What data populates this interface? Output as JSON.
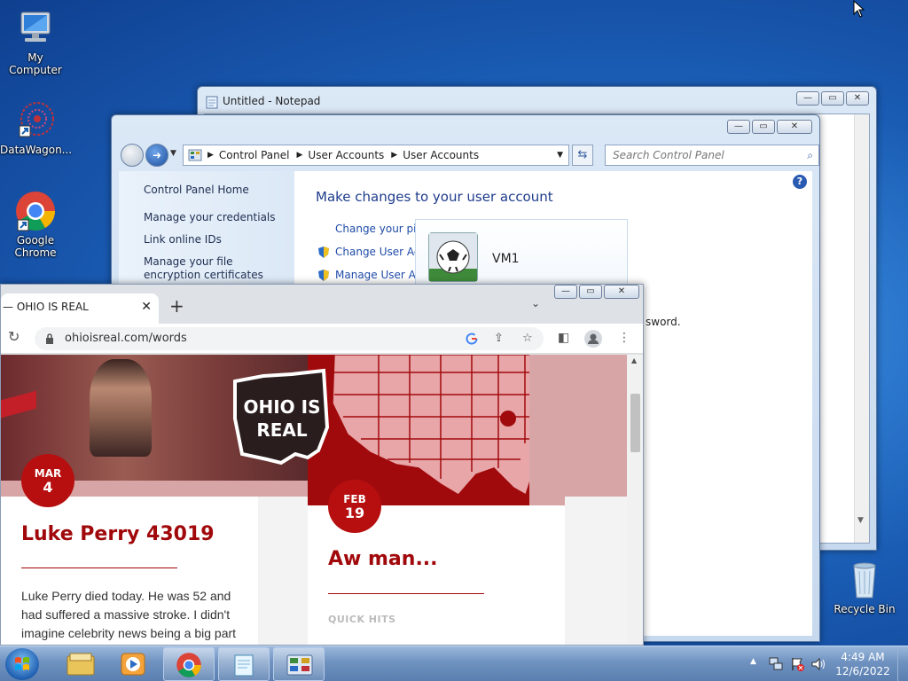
{
  "desktop": {
    "icons": [
      {
        "label": "My Computer",
        "icon": "computer-icon"
      },
      {
        "label": "DataWagon...",
        "icon": "datawagon-icon"
      },
      {
        "label": "Google Chrome",
        "icon": "chrome-icon"
      },
      {
        "label": "Recycle Bin",
        "icon": "recycle-bin-icon"
      }
    ]
  },
  "notepad": {
    "title": "Untitled - Notepad"
  },
  "control_panel": {
    "breadcrumb": [
      "Control Panel",
      "User Accounts",
      "User Accounts"
    ],
    "search_placeholder": "Search Control Panel",
    "left_links": [
      "Control Panel Home",
      "Manage your credentials",
      "Link online IDs",
      "Manage your file encryption certificates"
    ],
    "heading": "Make changes to your user account",
    "main_links": [
      "Change your picture",
      "Change User Account Control settings",
      "Manage User Accounts"
    ],
    "user_name": "VM1",
    "partial_text": "sword."
  },
  "chrome": {
    "tab_title": "— OHIO IS REAL",
    "url": "ohioisreal.com/words",
    "posts": [
      {
        "month": "MAR",
        "day": "4",
        "title": "Luke Perry 43019",
        "excerpt": "Luke Perry died today. He was 52 and had suffered a massive stroke. I didn't imagine celebrity news being a big part"
      },
      {
        "month": "FEB",
        "day": "19",
        "title": "Aw man...",
        "section": "QUICK HITS"
      }
    ],
    "logo_text": "OHIO IS REAL"
  },
  "taskbar": {
    "time": "4:49 AM",
    "date": "12/6/2022",
    "apps": [
      "start-orb",
      "explorer-icon",
      "media-player-icon",
      "chrome-icon",
      "notepad-icon",
      "control-panel-icon"
    ]
  },
  "colors": {
    "accent_red": "#a1080b",
    "badge_red": "#b70f0f",
    "link_blue": "#1f4ba8"
  }
}
